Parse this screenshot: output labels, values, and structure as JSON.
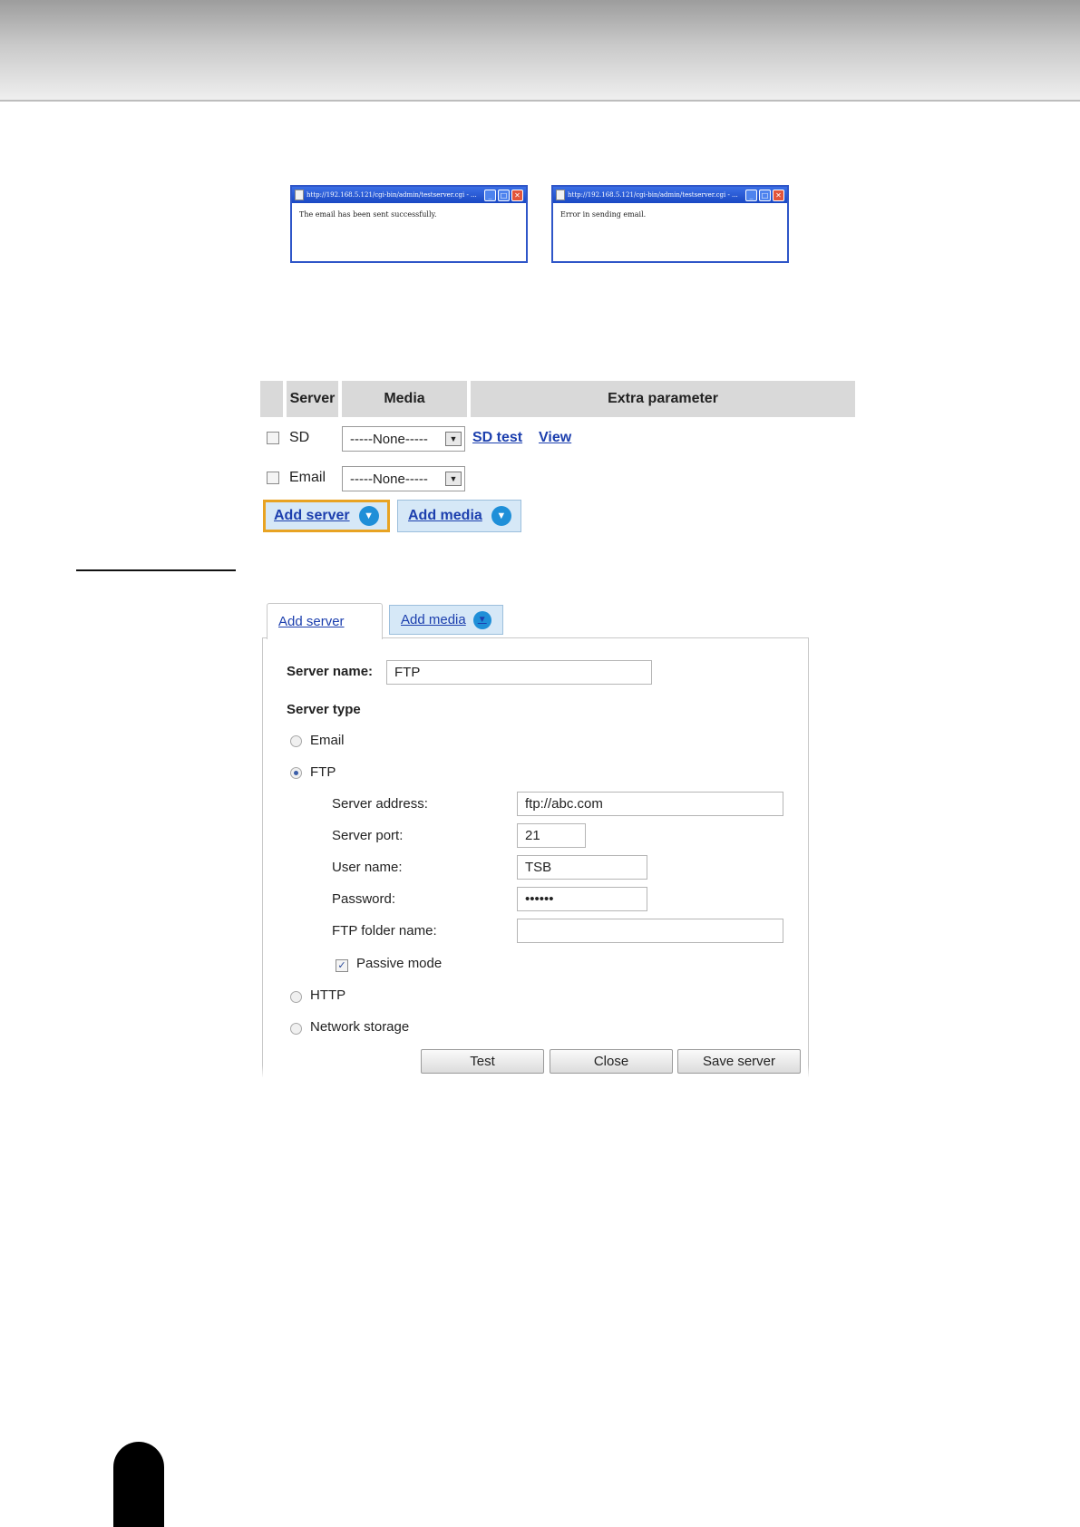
{
  "popups": [
    {
      "title": "http://192.168.5.121/cgi-bin/admin/testserver.cgi - ...",
      "message": "The email has been sent successfully."
    },
    {
      "title": "http://192.168.5.121/cgi-bin/admin/testserver.cgi - ...",
      "message": "Error in sending email."
    }
  ],
  "event_table": {
    "headers": {
      "server": "Server",
      "media": "Media",
      "extra": "Extra parameter"
    },
    "rows": [
      {
        "server": "SD",
        "media": "-----None-----",
        "links": [
          "SD test",
          "View"
        ]
      },
      {
        "server": "Email",
        "media": "-----None-----",
        "links": []
      }
    ],
    "add_server_label": "Add server",
    "add_media_label": "Add media"
  },
  "add_server_panel": {
    "tab_add_server": "Add server",
    "tab_add_media": "Add media",
    "server_name_label": "Server name:",
    "server_name_value": "FTP",
    "server_type_label": "Server type",
    "type_options": [
      "Email",
      "FTP",
      "HTTP",
      "Network storage"
    ],
    "selected_type": "FTP",
    "ftp": {
      "server_address_label": "Server address:",
      "server_address_value": "ftp://abc.com",
      "server_port_label": "Server port:",
      "server_port_value": "21",
      "user_name_label": "User name:",
      "user_name_value": "TSB",
      "password_label": "Password:",
      "password_value": "••••••",
      "folder_label": "FTP folder name:",
      "folder_value": "",
      "passive_mode_label": "Passive mode",
      "passive_mode_checked": true
    },
    "buttons": {
      "test": "Test",
      "close": "Close",
      "save": "Save server"
    }
  },
  "colors": {
    "link": "#1c3fae",
    "tab_blue": "#d6e8f7",
    "focus_outline": "#e8a323",
    "icon_blue": "#1f8fd8"
  }
}
